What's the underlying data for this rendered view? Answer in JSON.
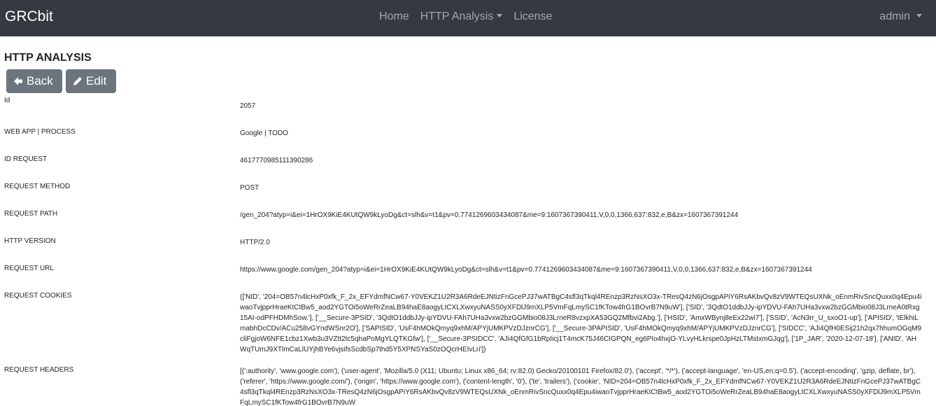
{
  "nav": {
    "brand": "GRCbit",
    "home": "Home",
    "http_analysis": "HTTP Analysis",
    "license": "License",
    "user": "admin"
  },
  "page": {
    "title": "HTTP ANALYSIS",
    "back_label": "Back",
    "edit_label": "Edit"
  },
  "fields": [
    {
      "label": "Id",
      "value": "2057"
    },
    {
      "label": "WEB APP | PROCESS",
      "value": "Google | TODO"
    },
    {
      "label": "ID REQUEST",
      "value": "4617770985111390286"
    },
    {
      "label": "REQUEST METHOD",
      "value": "POST"
    },
    {
      "label": "REQUEST PATH",
      "value": "/gen_204?atyp=i&ei=1HrOX9KiE4KUtQW9kLyoDg&ct=slh&v=t1&pv=0.7741269603434087&me=9:1607367390411,V,0,0,1366,637:832,e,B&zx=1607367391244"
    },
    {
      "label": "HTTP VERSION",
      "value": "HTTP/2.0"
    },
    {
      "label": "REQUEST URL",
      "value": "https://www.google.com/gen_204?atyp=i&ei=1HrOX9KiE4KUtQW9kLyoDg&ct=slh&v=t1&pv=0.7741269603434087&me=9:1607367390411,V,0,0,1366,637:832,e,B&zx=1607367391244"
    },
    {
      "label": "REQUEST COOKIES",
      "value": "(['NID', '204=OB57n4lcHxP0xfk_F_2x_EFYdmfNCw67-Y0VEKZ1U2R3A6RdeEJNtizFnGcePJ37wATBgC4sfl3qTkql4REnzp3RzNsXO3x-TResQ4zN6jOsgpAPiY6RsAKbvQv8zV9WTEQsUXNk_oEnmRivSncQuxx0q4Epu4iwaoTvjpprHraeKtCtBw5_aod2YGTOi5oWeRrZeaLB94haE8aogyLtCXLXwxyuNASS0yXFDlJ9mXLP5VmFqLmySC1fKTow4frG1BOvrB7N9uW'], ['SID', '3QdtO1ddbJJy-ipYDVU-FAh7UHa3vxw2bzGGMbio08J3LrneA0tRxg15AI-odPFHDMhSow.'], ['__Secure-3PSID', '3QdtO1ddbJJy-ipYDVU-FAh7UHa3vxw2bzGGMbio08J3LrneR8vzxpXA53GQ2Mfbvi2Abg.'], ['HSID', 'AmxWBynj8eEx22wi7'], ['SSID', 'AcN3rr_U_sxoO1-up'], ['APISID', 'tElkhiLmabhDcCDv/ACu258vGYndWSnr2O'], ['SAPISID', 'UsF4hMOkQmyq9xhM/APYjUMKPVzDJznrCG'], ['__Secure-3PAPISID', 'UsF4hMOkQmyq9xhM/APYjUMKPVzDJznrCG'], ['SIDCC', 'AJi4QfH0ESij21h2qx7hhumOGqM9cliFgjoW6NFE1cbz1Xwb3u3VZtt2tc5qhaPoMgYLQTKGfw'], ['__Secure-3PSIDCC', 'AJi4QfGfG1bRpIicj1T4mcK75J46CIGPQN_eg6PIo4hxjO-YLvyHLkrspe0JpHzLTMstxmGJqg'], ['1P_JAR', '2020-12-07-18'], ['ANID', 'AHWqTUmJ9XTlmCaLlUYjhBYe6vjsifsScdbSp7thd5Y5XPNSYaS0zOQcrHEIvLri'])"
    },
    {
      "label": "REQUEST HEADERS",
      "value": "[(':authority', 'www.google.com'), ('user-agent', 'Mozilla/5.0 (X11; Ubuntu; Linux x86_64; rv:82.0) Gecko/20100101 Firefox/82.0'), ('accept', '*/*'), ('accept-language', 'en-US,en;q=0.5'), ('accept-encoding', 'gzip, deflate, br'), ('referer', 'https://www.google.com/'), ('origin', 'https://www.google.com'), ('content-length', '0'), ('te', 'trailers'), ('cookie', 'NID=204=OB57n4lcHxP0xfk_F_2x_EFYdmfNCw67-Y0VEKZ1U2R3A6RdeEJNtizFnGcePJ37wATBgC4sfl3qTkql4REnzp3RzNsXO3x-TResQ4zN6jOsgpAPiY6RsAKbvQv8zV9WTEQsUXNk_oEnmRivSncQuxx0q4Epu4iwaoTvjpprHraeKtCtBw5_aod2YGTOi5oWeRrZeaLB94haE8aogyLtCXLXwxyuNASS0yXFDlJ9mXLP5VmFqLmySC1fKTow4frG1BOvrB7N9uW"
    }
  ],
  "colors": {
    "navbar": "#343a40",
    "button": "#6c757d"
  }
}
